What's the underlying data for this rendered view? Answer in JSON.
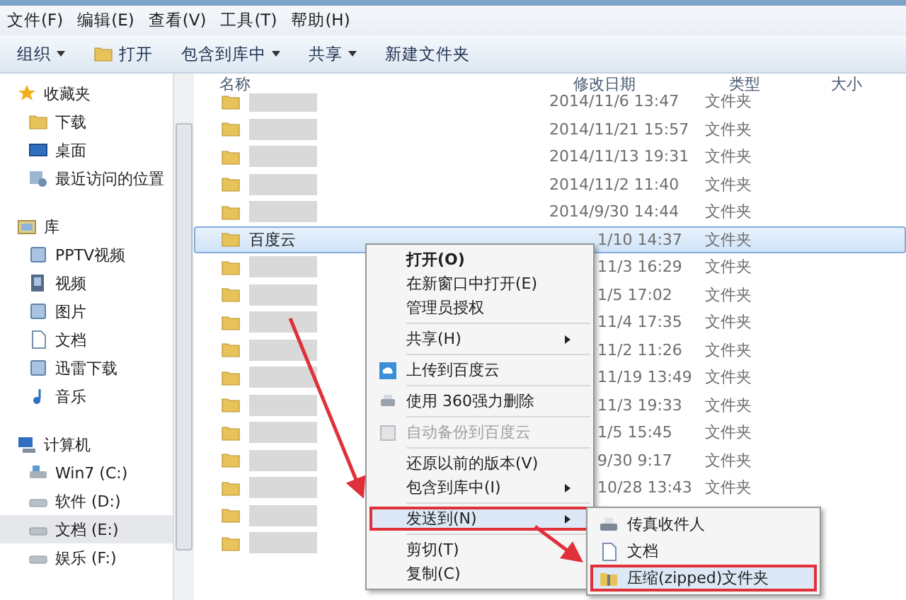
{
  "menu_bar": [
    "文件(F)",
    "编辑(E)",
    "查看(V)",
    "工具(T)",
    "帮助(H)"
  ],
  "toolbar": [
    {
      "label": "组织",
      "dropdown": true
    },
    {
      "label": "打开",
      "dropdown": false
    },
    {
      "label": "包含到库中",
      "dropdown": true
    },
    {
      "label": "共享",
      "dropdown": true
    },
    {
      "label": "新建文件夹",
      "dropdown": false
    }
  ],
  "sidebar": {
    "groups": [
      {
        "label": "收藏夹",
        "items": [
          {
            "label": "下载",
            "selected": false
          },
          {
            "label": "桌面",
            "selected": false
          },
          {
            "label": "最近访问的位置",
            "selected": false
          }
        ]
      },
      {
        "label": "库",
        "items": [
          {
            "label": "PPTV视频",
            "selected": false
          },
          {
            "label": "视频",
            "selected": false
          },
          {
            "label": "图片",
            "selected": false
          },
          {
            "label": "文档",
            "selected": false
          },
          {
            "label": "迅雷下载",
            "selected": false
          },
          {
            "label": "音乐",
            "selected": false
          }
        ]
      },
      {
        "label": "计算机",
        "items": [
          {
            "label": "Win7 (C:)",
            "selected": false
          },
          {
            "label": "软件 (D:)",
            "selected": false
          },
          {
            "label": "文档 (E:)",
            "selected": true
          },
          {
            "label": "娱乐 (F:)",
            "selected": false
          }
        ]
      }
    ]
  },
  "table": {
    "columns": [
      "名称",
      "修改日期",
      "类型",
      "大小"
    ],
    "rows": [
      {
        "date": "2014/11/6 13:47",
        "type": "文件夹",
        "selected": false
      },
      {
        "date": "2014/11/21 15:57",
        "type": "文件夹",
        "selected": false
      },
      {
        "date": "2014/11/13 19:31",
        "type": "文件夹",
        "selected": false
      },
      {
        "date": "2014/11/2 11:40",
        "type": "文件夹",
        "selected": false
      },
      {
        "date": "2014/9/30 14:44",
        "type": "文件夹",
        "selected": false
      },
      {
        "name": "百度云",
        "date": "1/10 14:37",
        "type": "文件夹",
        "selected": true
      },
      {
        "date": "11/3 16:29",
        "type": "文件夹",
        "selected": false
      },
      {
        "date": "1/5 17:02",
        "type": "文件夹",
        "selected": false
      },
      {
        "date": "11/4 17:35",
        "type": "文件夹",
        "selected": false
      },
      {
        "date": "11/2 11:26",
        "type": "文件夹",
        "selected": false
      },
      {
        "date": "11/19 13:49",
        "type": "文件夹",
        "selected": false
      },
      {
        "date": "11/3 19:33",
        "type": "文件夹",
        "selected": false
      },
      {
        "date": "1/5 15:45",
        "type": "文件夹",
        "selected": false
      },
      {
        "date": "9/30 9:17",
        "type": "文件夹",
        "selected": false
      },
      {
        "date": "10/28 13:43",
        "type": "文件夹",
        "selected": false
      },
      {
        "selected": false
      },
      {
        "selected": false
      }
    ]
  },
  "context_menu": {
    "items": [
      {
        "kind": "item",
        "label": "打开(O)",
        "bold": true,
        "disabled": false,
        "submenu": false,
        "selected": false
      },
      {
        "kind": "item",
        "label": "在新窗口中打开(E)",
        "bold": false,
        "disabled": false,
        "submenu": false,
        "selected": false
      },
      {
        "kind": "item",
        "label": "管理员授权",
        "bold": false,
        "disabled": false,
        "submenu": false,
        "selected": false
      },
      {
        "kind": "separator"
      },
      {
        "kind": "item",
        "label": "共享(H)",
        "bold": false,
        "disabled": false,
        "submenu": true,
        "selected": false
      },
      {
        "kind": "separator"
      },
      {
        "kind": "item",
        "label": "上传到百度云",
        "bold": false,
        "disabled": false,
        "submenu": false,
        "selected": false
      },
      {
        "kind": "separator"
      },
      {
        "kind": "item",
        "label": "使用 360强力删除",
        "bold": false,
        "disabled": false,
        "submenu": false,
        "selected": false
      },
      {
        "kind": "separator"
      },
      {
        "kind": "item",
        "label": "自动备份到百度云",
        "bold": false,
        "disabled": true,
        "submenu": false,
        "selected": false
      },
      {
        "kind": "separator"
      },
      {
        "kind": "item",
        "label": "还原以前的版本(V)",
        "bold": false,
        "disabled": false,
        "submenu": false,
        "selected": false
      },
      {
        "kind": "item",
        "label": "包含到库中(I)",
        "bold": false,
        "disabled": false,
        "submenu": true,
        "selected": false
      },
      {
        "kind": "separator"
      },
      {
        "kind": "item",
        "label": "发送到(N)",
        "bold": false,
        "disabled": false,
        "submenu": true,
        "selected": true
      },
      {
        "kind": "separator"
      },
      {
        "kind": "item",
        "label": "剪切(T)",
        "bold": false,
        "disabled": false,
        "submenu": false,
        "selected": false
      },
      {
        "kind": "item",
        "label": "复制(C)",
        "bold": false,
        "disabled": false,
        "submenu": false,
        "selected": false
      }
    ]
  },
  "send_to_menu": {
    "items": [
      {
        "label": "传真收件人",
        "selected": false
      },
      {
        "label": "文档",
        "selected": false
      },
      {
        "label": "压缩(zipped)文件夹",
        "selected": true
      }
    ]
  }
}
